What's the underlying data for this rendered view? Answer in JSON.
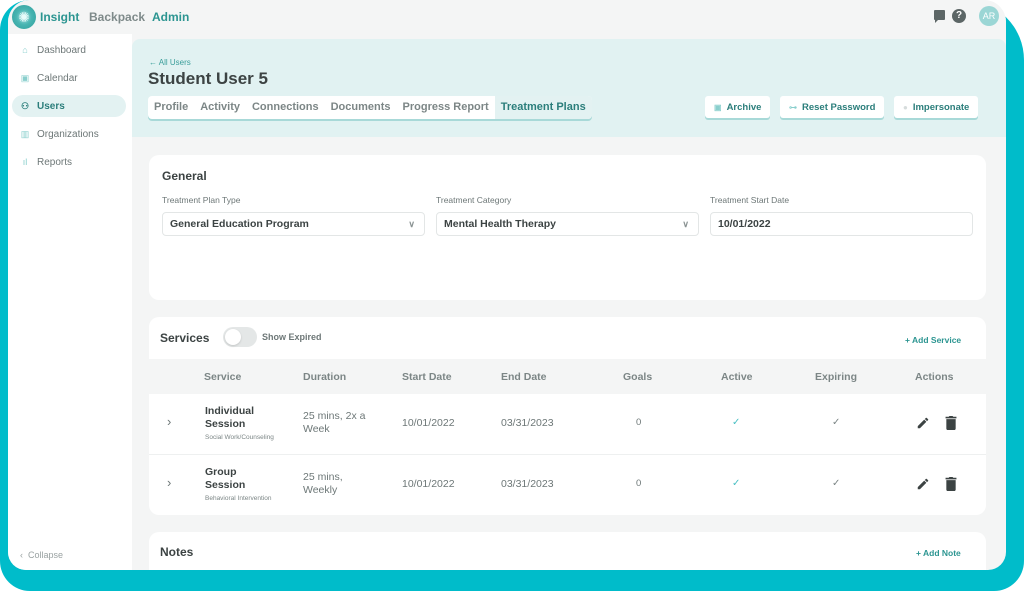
{
  "topbar": {
    "brand": "Insight",
    "nav": [
      "Backpack",
      "Admin"
    ],
    "avatar_initials": "AR",
    "icons": [
      "chat-icon",
      "help-icon"
    ]
  },
  "sidebar": {
    "items": [
      {
        "label": "Dashboard",
        "icon": "home-icon",
        "active": false
      },
      {
        "label": "Calendar",
        "icon": "calendar-icon",
        "active": false
      },
      {
        "label": "Users",
        "icon": "users-icon",
        "active": true
      },
      {
        "label": "Organizations",
        "icon": "building-icon",
        "active": false
      },
      {
        "label": "Reports",
        "icon": "bar-chart-icon",
        "active": false
      }
    ],
    "collapse_label": "Collapse"
  },
  "header": {
    "back_link": "← All Users",
    "title": "Student User 5",
    "tabs": [
      "Profile",
      "Activity",
      "Connections",
      "Documents",
      "Progress Report",
      "Treatment Plans"
    ],
    "active_tab": "Treatment Plans",
    "buttons": {
      "archive": "Archive",
      "reset_password": "Reset Password",
      "impersonate": "Impersonate"
    }
  },
  "general": {
    "title": "General",
    "plan_type_label": "Treatment Plan Type",
    "plan_type_value": "General Education Program",
    "category_label": "Treatment Category",
    "category_value": "Mental Health Therapy",
    "start_date_label": "Treatment Start Date",
    "start_date_value": "10/01/2022"
  },
  "services": {
    "title": "Services",
    "toggle_label": "Show Expired",
    "toggle_on": false,
    "add_label": "+ Add Service",
    "columns": [
      "Service",
      "Duration",
      "Start Date",
      "End Date",
      "Goals",
      "Active",
      "Expiring",
      "Actions"
    ],
    "rows": [
      {
        "name_line1": "Individual",
        "name_line2": "Session",
        "subtitle": "Social Work/Counseling",
        "duration_line1": "25 mins, 2x a",
        "duration_line2": "Week",
        "start": "10/01/2022",
        "end": "03/31/2023",
        "goals": "0",
        "active": "✓",
        "expiring": "✓"
      },
      {
        "name_line1": "Group",
        "name_line2": "Session",
        "subtitle": "Behavioral Intervention",
        "duration_line1": "25 mins,",
        "duration_line2": "Weekly",
        "start": "10/01/2022",
        "end": "03/31/2023",
        "goals": "0",
        "active": "✓",
        "expiring": "✓"
      }
    ]
  },
  "notes": {
    "title": "Notes",
    "add_label": "+ Add Note"
  },
  "colors": {
    "accent": "#2c9591",
    "frame": "#00bcca",
    "header_bg": "#e1f2f2"
  }
}
